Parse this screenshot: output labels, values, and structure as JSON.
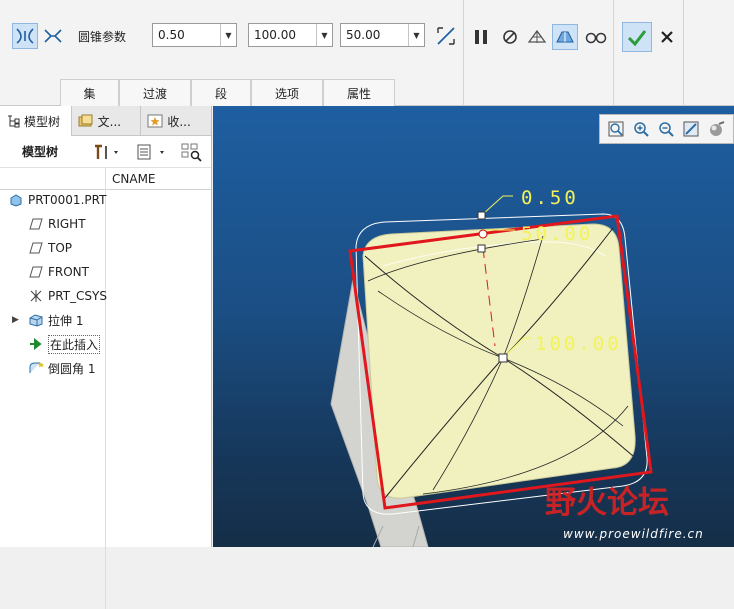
{
  "ribbon": {
    "param_label": "圆锥参数",
    "values": [
      "0.50",
      "100.00",
      "50.00"
    ],
    "tabs": [
      "集",
      "过渡",
      "段",
      "选项",
      "属性"
    ]
  },
  "left_panel": {
    "tabs": [
      "模型树",
      "文...",
      "收..."
    ],
    "toolbar_label": "模型树",
    "column_header": "CNAME",
    "tree": [
      {
        "label": "PRT0001.PRT"
      },
      {
        "label": "RIGHT"
      },
      {
        "label": "TOP"
      },
      {
        "label": "FRONT"
      },
      {
        "label": "PRT_CSYS"
      },
      {
        "label": "拉伸 1"
      },
      {
        "label": "在此插入"
      },
      {
        "label": "倒圆角 1"
      }
    ]
  },
  "viewport": {
    "dim_labels": [
      "0.50",
      "50.00",
      "100.00"
    ],
    "watermark": {
      "title": "野火论坛",
      "url": "www.proewildfire.cn"
    }
  },
  "colors": {
    "accent": "#1f5fa3",
    "highlight_red": "#e0171d",
    "model": "#f1f1bf",
    "dim_yellow": "#f2f25a"
  }
}
